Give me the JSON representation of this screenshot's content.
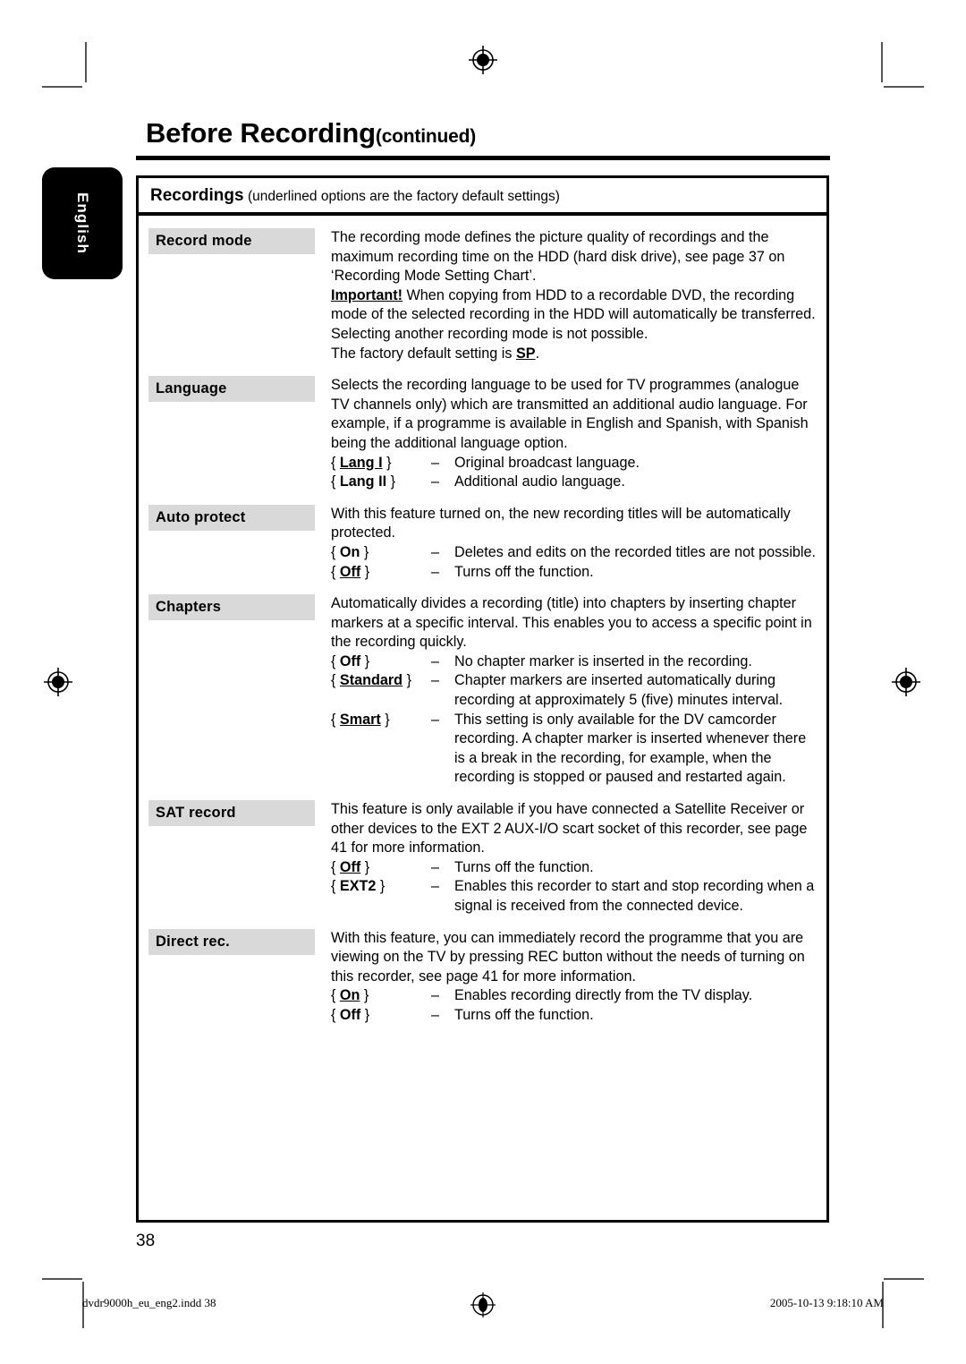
{
  "page": {
    "title_main": "Before Recording",
    "title_continued": "(continued)",
    "number": "38",
    "language_tab": "English"
  },
  "table": {
    "header_strong": "Recordings",
    "header_note": "(underlined options are the factory default settings)",
    "rows": [
      {
        "label": "Record mode",
        "paragraphs": [
          "The recording mode defines the picture quality of recordings and the maximum recording time on the HDD (hard disk drive), see page 37 on ‘Recording Mode Setting Chart’.",
          "Important! When copying from HDD to a recordable DVD, the recording mode of the selected recording in the HDD will automatically be transferred. Selecting another recording mode is not possible.",
          "The factory default setting is SP."
        ],
        "important_word": "Important!",
        "default_word": "SP",
        "options": []
      },
      {
        "label": "Language",
        "paragraphs": [
          "Selects the recording language to be used for TV programmes (analogue TV channels only) which are transmitted an additional audio language. For example, if a programme is available in English and Spanish, with Spanish being the additional language option."
        ],
        "options": [
          {
            "key": "Lang I",
            "underlined": true,
            "desc": "Original broadcast language."
          },
          {
            "key": "Lang II",
            "underlined": false,
            "desc": "Additional audio language."
          }
        ]
      },
      {
        "label": "Auto protect",
        "paragraphs": [
          "With this feature turned on, the new recording titles will be automatically protected."
        ],
        "options": [
          {
            "key": "On",
            "underlined": false,
            "desc": "Deletes and edits on the recorded titles are not possible."
          },
          {
            "key": "Off",
            "underlined": true,
            "desc": "Turns off the function."
          }
        ]
      },
      {
        "label": "Chapters",
        "paragraphs": [
          "Automatically divides a recording (title) into chapters by inserting chapter markers at a specific interval. This enables you to access a specific point in the recording quickly."
        ],
        "options": [
          {
            "key": "Off",
            "underlined": false,
            "desc": "No chapter marker is inserted in the recording."
          },
          {
            "key": "Standard",
            "underlined": true,
            "desc": "Chapter markers are inserted automatically during recording at approximately 5 (five) minutes interval."
          },
          {
            "key": "Smart",
            "underlined": true,
            "desc": "This setting is only available for the DV camcorder recording. A chapter marker is inserted whenever there is a break in the recording, for example, when the recording is stopped or paused and restarted again."
          }
        ]
      },
      {
        "label": "SAT record",
        "paragraphs": [
          "This feature is only available if you have connected a Satellite Receiver or other devices to the EXT 2 AUX-I/O scart socket of this recorder, see page 41 for more information."
        ],
        "options": [
          {
            "key": "Off",
            "underlined": true,
            "desc": "Turns off the function."
          },
          {
            "key": "EXT2",
            "underlined": false,
            "desc": "Enables this recorder to start and stop recording when a signal is received from the connected device."
          }
        ]
      },
      {
        "label": "Direct rec.",
        "paragraphs": [
          "With this feature, you can immediately record the programme that you are viewing on the TV by pressing REC button without the needs of turning on this recorder, see page 41 for more information."
        ],
        "options": [
          {
            "key": "On",
            "underlined": true,
            "desc": "Enables recording directly from the TV display."
          },
          {
            "key": "Off",
            "underlined": false,
            "desc": "Turns off the function."
          }
        ]
      }
    ]
  },
  "footer": {
    "file_name": "dvdr9000h_eu_eng2.indd   38",
    "timestamp": "2005-10-13   9:18:10 AM"
  },
  "colors": {
    "label_background": "#d9d9d9",
    "rule": "#000000",
    "tab_background": "#000000",
    "crop_mark": "#555555"
  }
}
